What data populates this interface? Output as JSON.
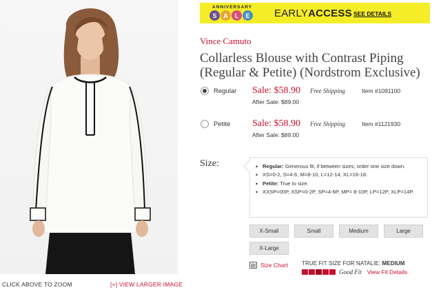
{
  "image": {
    "zoom_hint": "CLICK ABOVE TO ZOOM",
    "larger_link": "[+] VIEW LARGER IMAGE"
  },
  "promo": {
    "anniversary": "ANNIVERSARY",
    "sale_letters": [
      "S",
      "A",
      "L",
      "E"
    ],
    "early_prefix": "EARLY",
    "early_bold": "ACCESS",
    "see_details": "SEE DETAILS",
    "background_color": "#f5ed27"
  },
  "product": {
    "brand": "Vince Camuto",
    "title": "Collarless Blouse with Contrast Piping (Regular & Petite) (Nordstrom Exclusive)"
  },
  "variants": [
    {
      "label": "Regular",
      "sale": "Sale: $58.90",
      "after": "After Sale: $89.00",
      "shipping": "Free Shipping",
      "item": "Item #1091100",
      "selected": true
    },
    {
      "label": "Petite",
      "sale": "Sale: $58.90",
      "after": "After Sale: $89.00",
      "shipping": "Free Shipping",
      "item": "Item #1121930",
      "selected": false
    }
  ],
  "size": {
    "label": "Size:",
    "fit_notes": [
      {
        "bold": "Regular:",
        "text": " Generous fit; if between sizes, order one size down."
      },
      {
        "bold": "",
        "text": "XS=0-2, S=4-6, M=8-10, L=12-14, XL=16-18."
      },
      {
        "bold": "Petite:",
        "text": " True to size."
      },
      {
        "bold": "",
        "text": "XXSP=00P, XSP=0-2P, SP=4-6P, MP= 8-10P, LP=12P, XLP=14P."
      }
    ],
    "options": [
      "X-Small",
      "Small",
      "Medium",
      "Large",
      "X-Large"
    ]
  },
  "fit": {
    "size_chart": "Size Chart",
    "true_to_size_prefix": "TRUE FIT SIZE FOR NATALIE: ",
    "true_to_size_value": "MEDIUM",
    "rating_label": "Good Fit",
    "view_details": "View Fit Details",
    "accent_color": "#c8102e"
  }
}
